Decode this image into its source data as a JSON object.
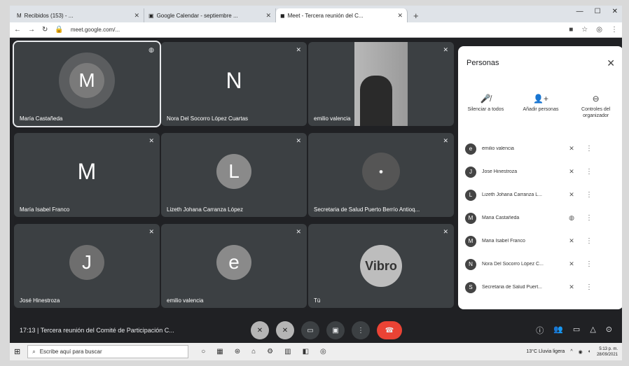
{
  "browser": {
    "tabs": [
      {
        "title": "Recibidos (153) - ..."
      },
      {
        "title": "Google Calendar - septiembre ..."
      },
      {
        "title": "Meet - Tercera reunión del C..."
      }
    ],
    "url": "meet.google.com/..."
  },
  "tiles": [
    {
      "name": "María Castañeda",
      "initial": "M"
    },
    {
      "name": "Nora Del Socorro López Cuartas",
      "initial": "N"
    },
    {
      "name": "emilio valencia",
      "initial": ""
    },
    {
      "name": "María Isabel Franco",
      "initial": "M"
    },
    {
      "name": "Lizeth Johana Carranza López",
      "initial": "L"
    },
    {
      "name": "Secretaria de Salud Puerto Berrío Antioq...",
      "initial": ""
    },
    {
      "name": "José Hinestroza",
      "initial": "J"
    },
    {
      "name": "emilio valencia",
      "initial": "e"
    },
    {
      "name": "Tú",
      "initial": "Vibro"
    }
  ],
  "panel": {
    "title": "Personas",
    "actions": [
      {
        "label": "Silenciar a todos",
        "icon": "mic-off-icon"
      },
      {
        "label": "Añadir personas",
        "icon": "add-person-icon"
      },
      {
        "label": "Controles del organizador",
        "icon": "host-controls-icon"
      }
    ],
    "people": [
      {
        "name": "emilio valencia",
        "initial": "e"
      },
      {
        "name": "Jose Hinestroza",
        "initial": "J"
      },
      {
        "name": "Lizeth Johana Carranza L...",
        "initial": "L"
      },
      {
        "name": "Maria Castañeda",
        "initial": "M"
      },
      {
        "name": "Maria Isabel Franco",
        "initial": "M"
      },
      {
        "name": "Nora Del Socorro López C...",
        "initial": "N"
      },
      {
        "name": "Secretaria de Salud Puert...",
        "initial": "S"
      }
    ]
  },
  "bottombar": {
    "meeting_info": "17:13 | Tercera reunión del Comité de Participación C..."
  },
  "taskbar": {
    "search_placeholder": "Escribe aquí para buscar",
    "weather": "13°C Lluvia ligera",
    "time": "5:13 p. m.",
    "date": "28/09/2021"
  }
}
